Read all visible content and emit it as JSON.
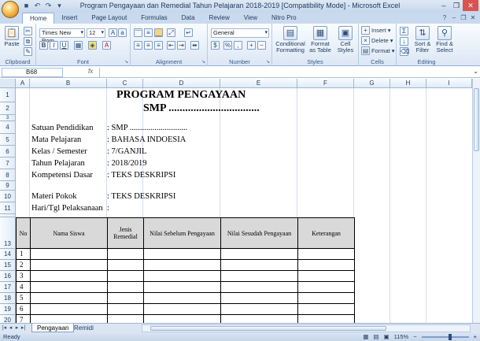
{
  "window": {
    "title": "Program Pengayaan dan Remedial Tahun Pelajaran 2018-2019  [Compatibility Mode] - Microsoft Excel"
  },
  "ribbon": {
    "tabs": [
      "Home",
      "Insert",
      "Page Layout",
      "Formulas",
      "Data",
      "Review",
      "View",
      "Nitro Pro"
    ],
    "clipboard": {
      "label": "Clipboard",
      "paste": "Paste"
    },
    "font": {
      "label": "Font",
      "name": "Times New Rom",
      "size": "12"
    },
    "alignment": {
      "label": "Alignment"
    },
    "number": {
      "label": "Number",
      "format": "General"
    },
    "styles": {
      "label": "Styles",
      "conditional": "Conditional Formatting",
      "format_table": "Format as Table",
      "cell_styles": "Cell Styles"
    },
    "cells": {
      "label": "Cells",
      "insert": "Insert",
      "delete": "Delete",
      "format": "Format"
    },
    "editing": {
      "label": "Editing",
      "sort": "Sort & Filter",
      "find": "Find & Select"
    }
  },
  "formula_bar": {
    "name_box": "B68",
    "fx": "fx",
    "content": ""
  },
  "columns": [
    "A",
    "B",
    "C",
    "D",
    "E",
    "F",
    "G",
    "H",
    "I"
  ],
  "rows": [
    "1",
    "2",
    "3",
    "4",
    "5",
    "6",
    "7",
    "8",
    "9",
    "10",
    "11",
    "12",
    "13",
    "14",
    "15",
    "16",
    "17",
    "18",
    "19",
    "20"
  ],
  "sheet": {
    "title1": "PROGRAM PENGAYAAN",
    "title2": "SMP .................................",
    "info": [
      {
        "label": "Satuan Pendidikan",
        "value": ": SMP ............................"
      },
      {
        "label": "Mata Pelajaran",
        "value": ": BAHASA INDOESIA"
      },
      {
        "label": "Kelas / Semester",
        "value": ": 7/GANJIL"
      },
      {
        "label": "Tahun Pelajaran",
        "value": ": 2018/2019"
      },
      {
        "label": "Kompetensi Dasar",
        "value": ": TEKS DESKRIPSI"
      },
      {
        "label": "Materi Pokok",
        "value": ": TEKS DESKRIPSI"
      },
      {
        "label": "Hari/Tgl Pelaksanaan",
        "value": ":"
      }
    ],
    "table_headers": [
      "No",
      "Nama Siswa",
      "Jenis Remedial",
      "Nilai  Sebelum  Pengayaan",
      "Nilai  Sesudah  Pengayaan",
      "Keterangan"
    ],
    "row_numbers": [
      "1",
      "2",
      "3",
      "4",
      "5",
      "6",
      "7"
    ]
  },
  "sheet_tabs": [
    "Pengayaan",
    "Remidi"
  ],
  "status": {
    "left": "Ready",
    "zoom": "115%"
  }
}
